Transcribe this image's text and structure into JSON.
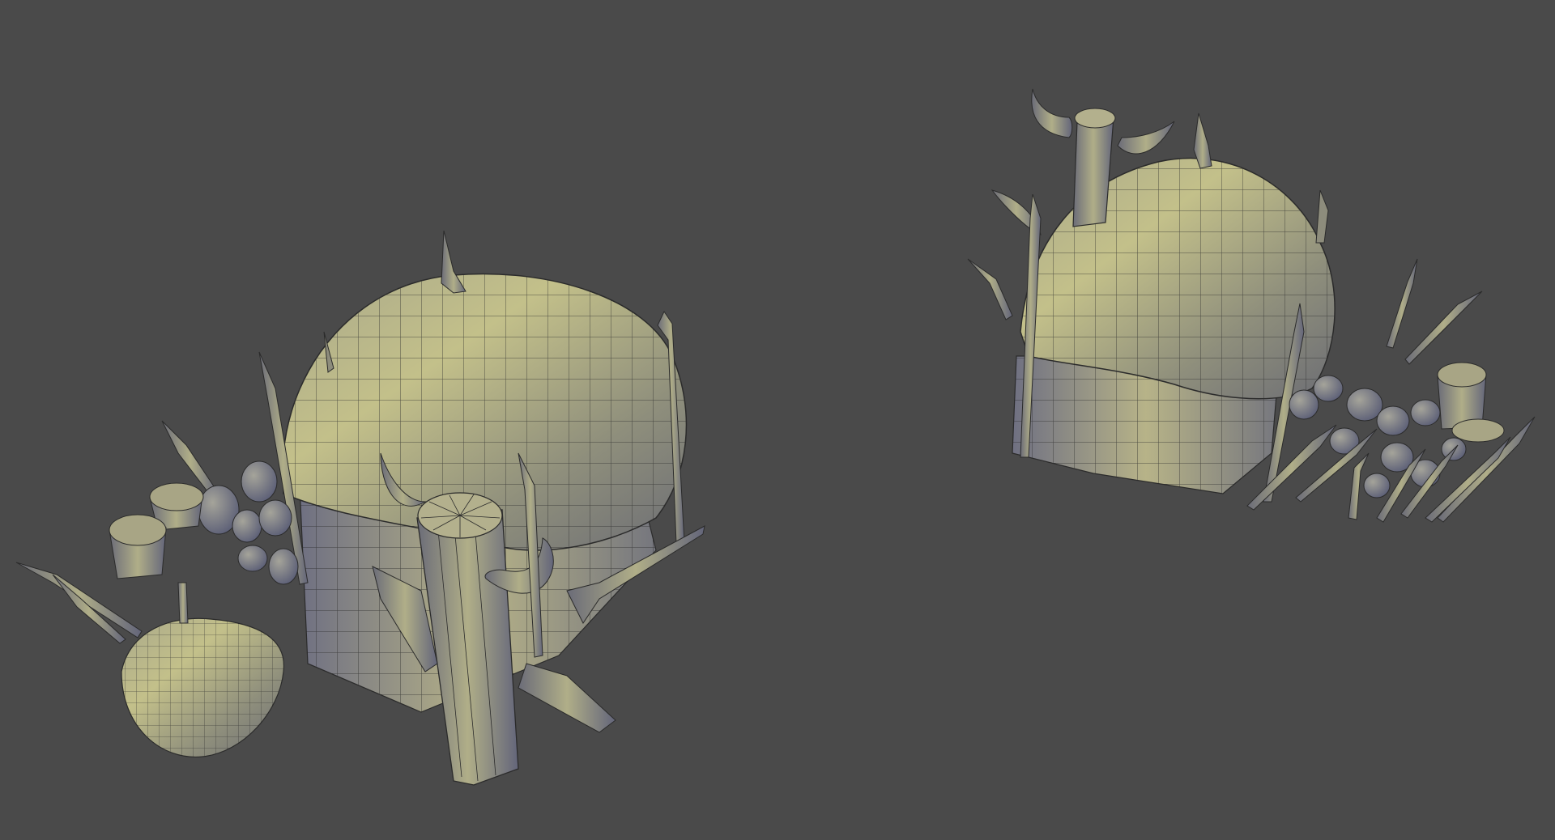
{
  "scene": {
    "background_color": "#4a4a4a",
    "model_color": "#8f8e74",
    "model_highlight": "#c2bf7c",
    "model_shadow": "#5a5f7a",
    "wire_color": "#2a2a2a",
    "objects": [
      "hut-front-view",
      "hut-back-view"
    ]
  }
}
